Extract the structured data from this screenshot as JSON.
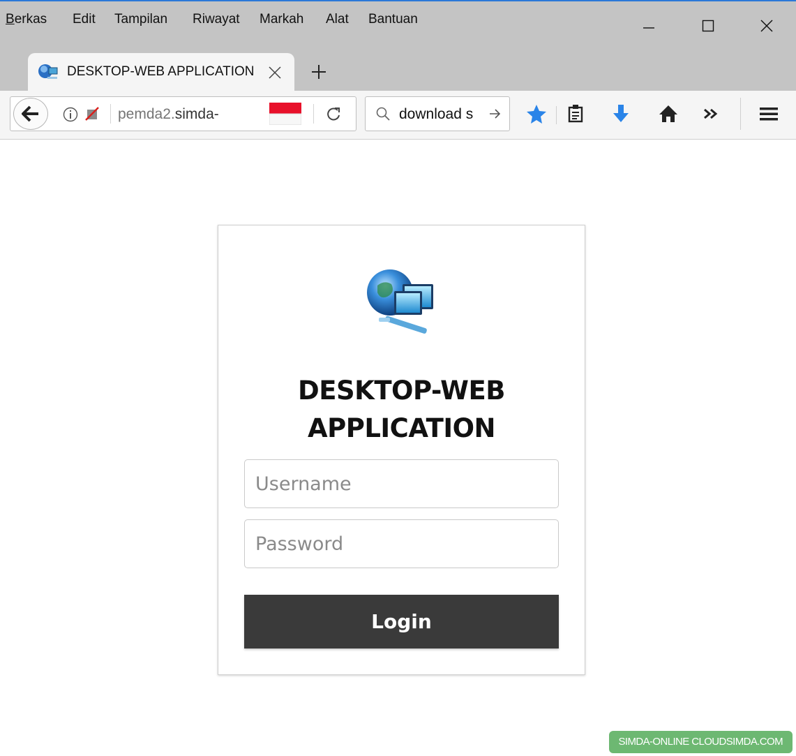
{
  "menu": {
    "berkas": "Berkas",
    "edit": "Edit",
    "tampilan": "Tampilan",
    "riwayat": "Riwayat",
    "markah": "Markah",
    "alat": "Alat",
    "bantuan": "Bantuan"
  },
  "tab": {
    "title": "DESKTOP-WEB APPLICATION"
  },
  "navbar": {
    "url_host": "pemda2.",
    "url_domain": "simda-",
    "search_text": "download s"
  },
  "login": {
    "title": "DESKTOP-WEB APPLICATION",
    "username_placeholder": "Username",
    "password_placeholder": "Password",
    "login_label": "Login"
  },
  "watermark": "SIMDA-ONLINE CLOUDSIMDA.COM",
  "colors": {
    "accent_blue": "#2b78d8",
    "button_dark": "#3a3a3a",
    "watermark_green": "#6db872",
    "flag_red": "#e8102a"
  },
  "icons": [
    "globe-computer-icon",
    "back-arrow-icon",
    "info-icon",
    "blocked-content-icon",
    "indonesia-flag-icon",
    "reload-icon",
    "search-icon",
    "go-arrow-icon",
    "bookmark-star-icon",
    "reading-list-icon",
    "download-icon",
    "home-icon",
    "overflow-chevron-icon",
    "hamburger-menu-icon"
  ]
}
